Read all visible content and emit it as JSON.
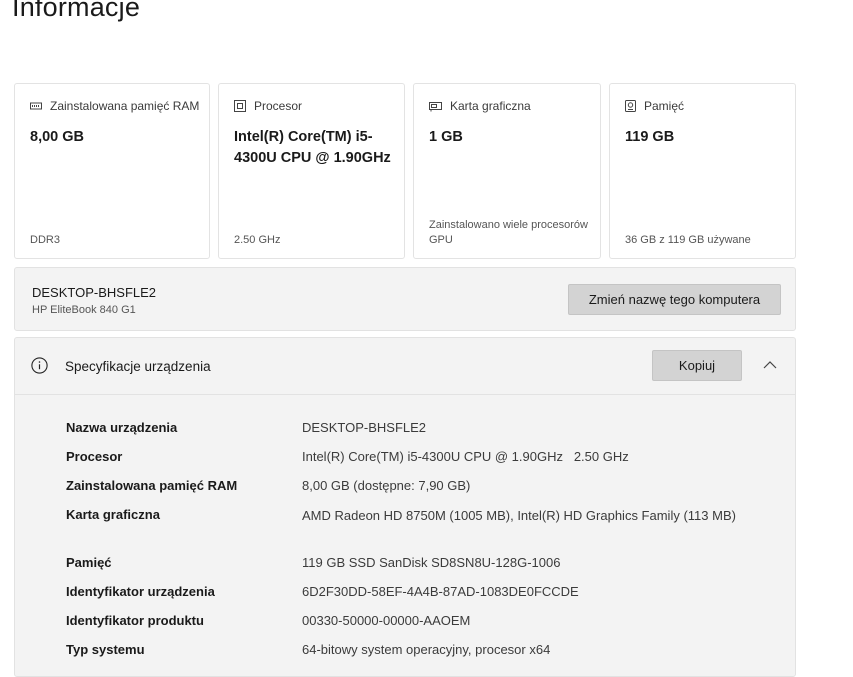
{
  "page": {
    "title": "Informacje"
  },
  "cards": [
    {
      "icon": "ram-icon",
      "label": "Zainstalowana pamięć RAM",
      "value": "8,00 GB",
      "footer": "DDR3"
    },
    {
      "icon": "cpu-icon",
      "label": "Procesor",
      "value": "Intel(R) Core(TM) i5-4300U CPU @ 1.90GHz",
      "footer": "2.50 GHz"
    },
    {
      "icon": "gpu-icon",
      "label": "Karta graficzna",
      "value": "1 GB",
      "footer": "Zainstalowano wiele procesorów GPU"
    },
    {
      "icon": "storage-icon",
      "label": "Pamięć",
      "value": "119 GB",
      "footer": "36 GB z 119 GB używane"
    }
  ],
  "device": {
    "name": "DESKTOP-BHSFLE2",
    "model": "HP EliteBook 840 G1",
    "rename_label": "Zmień nazwę tego komputera"
  },
  "specs": {
    "title": "Specyfikacje urządzenia",
    "copy_label": "Kopiuj",
    "rows": [
      {
        "key": "Nazwa urządzenia",
        "value": "DESKTOP-BHSFLE2"
      },
      {
        "key": "Procesor",
        "value": "Intel(R) Core(TM) i5-4300U CPU @ 1.90GHz   2.50 GHz"
      },
      {
        "key": "Zainstalowana pamięć RAM",
        "value": "8,00 GB (dostępne: 7,90 GB)"
      },
      {
        "key": "Karta graficzna",
        "value": "AMD Radeon HD 8750M (1005 MB), Intel(R) HD Graphics Family (113 MB)"
      },
      {
        "key": "Pamięć",
        "value": "119 GB SSD SanDisk SD8SN8U-128G-1006"
      },
      {
        "key": "Identyfikator urządzenia",
        "value": "6D2F30DD-58EF-4A4B-87AD-1083DE0FCCDE"
      },
      {
        "key": "Identyfikator produktu",
        "value": "00330-50000-00000-AAOEM"
      },
      {
        "key": "Typ systemu",
        "value": "64-bitowy system operacyjny, procesor x64"
      }
    ]
  }
}
